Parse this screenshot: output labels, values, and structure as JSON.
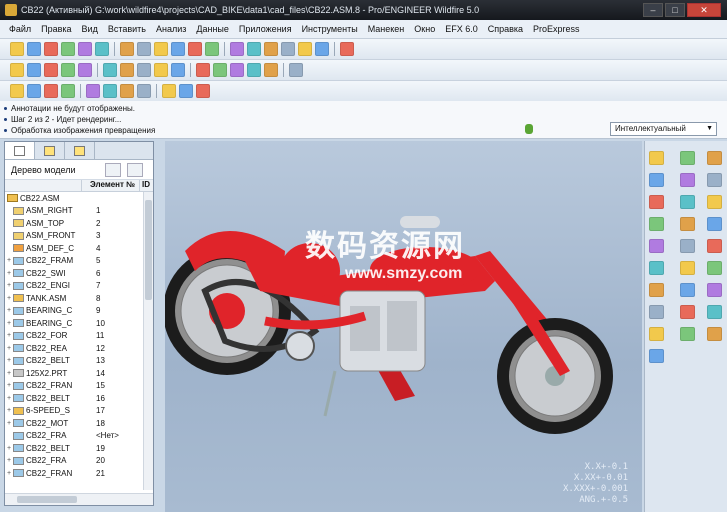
{
  "window": {
    "title": "CB22 (Активный) G:\\work\\wildfire4\\projects\\CAD_BIKE\\data1\\cad_files\\CB22.ASM.8 - Pro/ENGINEER Wildfire 5.0",
    "minimize": "–",
    "maximize": "□",
    "close": "✕"
  },
  "menu": [
    "Файл",
    "Правка",
    "Вид",
    "Вставить",
    "Анализ",
    "Данные",
    "Приложения",
    "Инструменты",
    "Манекен",
    "Окно",
    "EFX 6.0",
    "Справка",
    "ProExpress"
  ],
  "messages": [
    "Аннотации не будут отображены.",
    "Шаг 2 из 2 - Идет рендеринг...",
    "Обработка изображения превращения"
  ],
  "filter": {
    "selected": "Интеллектуальный"
  },
  "model_tree": {
    "title": "Дерево модели",
    "col_name": "",
    "col_element": "Элемент №",
    "col_id": "ID",
    "root": "CB22.ASM",
    "rows": [
      {
        "name": "ASM_RIGHT",
        "num": "1",
        "type": "plane",
        "exp": ""
      },
      {
        "name": "ASM_TOP",
        "num": "2",
        "type": "plane",
        "exp": ""
      },
      {
        "name": "ASM_FRONT",
        "num": "3",
        "type": "plane",
        "exp": ""
      },
      {
        "name": "ASM_DEF_C",
        "num": "4",
        "type": "csys",
        "exp": ""
      },
      {
        "name": "CB22_FRAM",
        "num": "5",
        "type": "part",
        "exp": "+"
      },
      {
        "name": "CB22_SWI",
        "num": "6",
        "type": "part",
        "exp": "+"
      },
      {
        "name": "CB22_ENGI",
        "num": "7",
        "type": "part",
        "exp": "+"
      },
      {
        "name": "TANK.ASM",
        "num": "8",
        "type": "asm",
        "exp": "+"
      },
      {
        "name": "BEARING_C",
        "num": "9",
        "type": "part",
        "exp": "+"
      },
      {
        "name": "BEARING_C",
        "num": "10",
        "type": "part",
        "exp": "+"
      },
      {
        "name": "CB22_FOR",
        "num": "11",
        "type": "part",
        "exp": "+"
      },
      {
        "name": "CB22_REA",
        "num": "12",
        "type": "part",
        "exp": "+"
      },
      {
        "name": "CB22_BELT",
        "num": "13",
        "type": "part",
        "exp": "+"
      },
      {
        "name": "125X2.PRT",
        "num": "14",
        "type": "prt",
        "exp": "+"
      },
      {
        "name": "CB22_FRAN",
        "num": "15",
        "type": "part",
        "exp": "+"
      },
      {
        "name": "CB22_BELT",
        "num": "16",
        "type": "part",
        "exp": "+"
      },
      {
        "name": "6-SPEED_S",
        "num": "17",
        "type": "asm",
        "exp": "+"
      },
      {
        "name": "CB22_MOT",
        "num": "18",
        "type": "part",
        "exp": "+"
      },
      {
        "name": "CB22_FRA",
        "num": "<Нет>",
        "type": "part",
        "exp": ""
      },
      {
        "name": "CB22_BELT",
        "num": "19",
        "type": "part",
        "exp": "+"
      },
      {
        "name": "CB22_FRA",
        "num": "20",
        "type": "part",
        "exp": "+"
      },
      {
        "name": "CB22_FRAN",
        "num": "21",
        "type": "part",
        "exp": "+"
      }
    ]
  },
  "viewport": {
    "watermark": "数码资源网",
    "watermark_url": "www.smzy.com",
    "orientation": [
      "X.X+-0.1",
      "X.XX+-0.01",
      "X.XXX+-0.001",
      "ANG.+-0.5"
    ]
  },
  "colors": {
    "bike_red": "#e0242a",
    "tire": "#1c1c1c",
    "chrome": "#d9dde2",
    "accent": "#2a7ad0"
  },
  "icons": {
    "toolbar": [
      "new-file-icon",
      "open-folder-icon",
      "save-icon",
      "print-icon",
      "copy-icon",
      "paste-icon",
      "regenerate-icon",
      "window-icon",
      "close-window-icon",
      "undo-icon",
      "redo-icon",
      "cut-icon",
      "copy2-icon",
      "paste2-icon",
      "delete-icon",
      "find-icon",
      "select-icon",
      "ok-icon",
      "help-icon"
    ],
    "toolbar2": [
      "shade-icon",
      "repaint-icon",
      "zoom-in-icon",
      "zoom-out-icon",
      "refit-icon",
      "orient-icon",
      "saved-views-icon",
      "layers-icon",
      "appearance-icon",
      "spin-center-icon",
      "datum-planes-icon",
      "datum-axes-icon",
      "datum-points-icon",
      "csys-icon",
      "annotations-icon",
      "display-style-icon"
    ],
    "toolbar3": [
      "component-icon",
      "explode-icon",
      "cross-section-icon",
      "measure-icon",
      "analysis-icon",
      "color-icon",
      "render-icon",
      "whats-this-icon",
      "info-icon",
      "globe-icon",
      "nav-icon"
    ]
  }
}
